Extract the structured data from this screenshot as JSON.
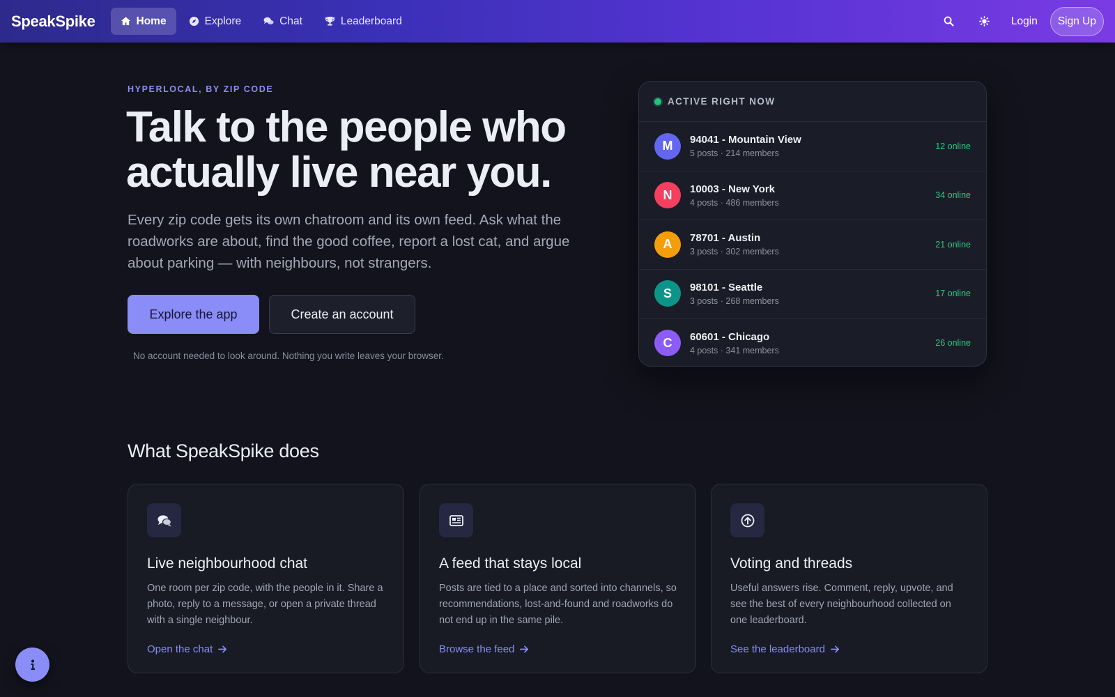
{
  "nav": {
    "brand": "SpeakSpike",
    "links": [
      {
        "label": "Home",
        "icon": "home-icon"
      },
      {
        "label": "Explore",
        "icon": "compass-icon"
      },
      {
        "label": "Chat",
        "icon": "chat-icon"
      },
      {
        "label": "Leaderboard",
        "icon": "trophy-icon"
      }
    ],
    "login": "Login",
    "signup": "Sign Up"
  },
  "hero": {
    "eyebrow": "HYPERLOCAL, BY ZIP CODE",
    "title": "Talk to the people who actually live near you.",
    "subtitle": "Every zip code gets its own chatroom and its own feed. Ask what the roadworks are about, find the good coffee, report a lost cat, and argue about parking — with neighbours, not strangers.",
    "primary_button": "Explore the app",
    "secondary_button": "Create an account",
    "note": "No account needed to look around. Nothing you write leaves your browser."
  },
  "active": {
    "title": "ACTIVE RIGHT NOW",
    "rows": [
      {
        "initial": "M",
        "name": "94041 - Mountain View",
        "meta": "5 posts · 214 members",
        "online": "12 online",
        "color": "#6366f1"
      },
      {
        "initial": "N",
        "name": "10003 - New York",
        "meta": "4 posts · 486 members",
        "online": "34 online",
        "color": "#f43f5e"
      },
      {
        "initial": "A",
        "name": "78701 - Austin",
        "meta": "3 posts · 302 members",
        "online": "21 online",
        "color": "#f59e0b"
      },
      {
        "initial": "S",
        "name": "98101 - Seattle",
        "meta": "3 posts · 268 members",
        "online": "17 online",
        "color": "#0d9488"
      },
      {
        "initial": "C",
        "name": "60601 - Chicago",
        "meta": "4 posts · 341 members",
        "online": "26 online",
        "color": "#8b5cf6"
      }
    ]
  },
  "features": {
    "title": "What SpeakSpike does",
    "cards": [
      {
        "icon": "chat-bubbles-icon",
        "title": "Live neighbourhood chat",
        "desc": "One room per zip code, with the people in it. Share a photo, reply to a message, or open a private thread with a single neighbour.",
        "link": "Open the chat"
      },
      {
        "icon": "newspaper-icon",
        "title": "A feed that stays local",
        "desc": "Posts are tied to a place and sorted into channels, so recommendations, lost-and-found and roadworks do not end up in the same pile.",
        "link": "Browse the feed"
      },
      {
        "icon": "upvote-icon",
        "title": "Voting and threads",
        "desc": "Useful answers rise. Comment, reply, upvote, and see the best of every neighbourhood collected on one leaderboard.",
        "link": "See the leaderboard"
      }
    ]
  },
  "colors": {
    "accent": "#8a8cf8",
    "online": "#2fc983",
    "background": "#12131c"
  }
}
